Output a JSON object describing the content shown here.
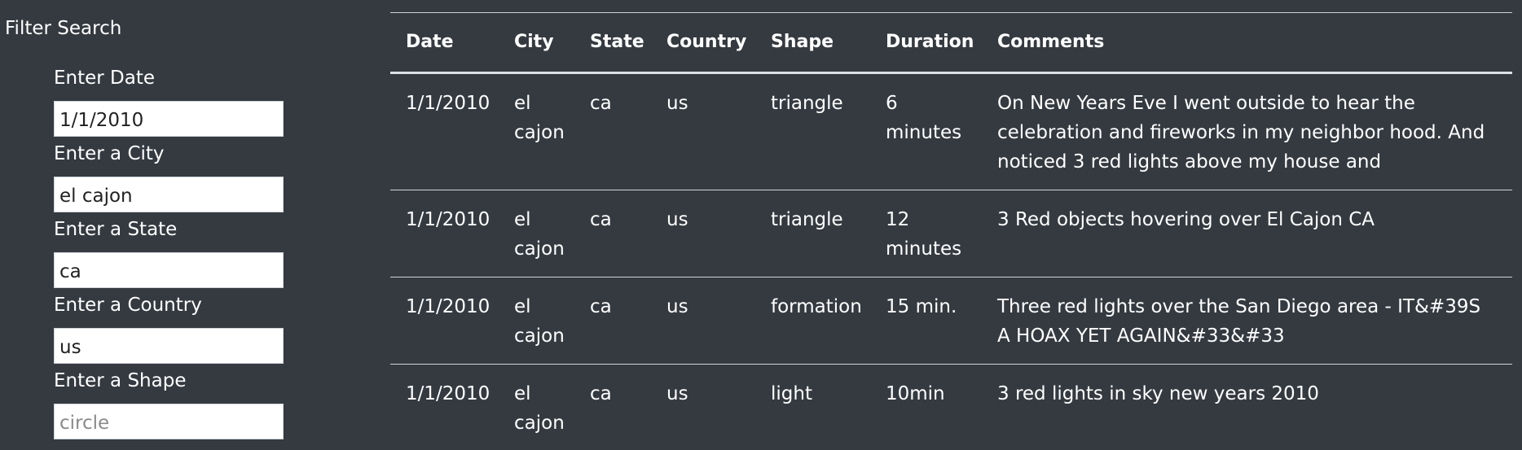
{
  "filter": {
    "title": "Filter Search",
    "fields": [
      {
        "label": "Enter Date",
        "value": "1/1/2010",
        "placeholder": ""
      },
      {
        "label": "Enter a City",
        "value": "el cajon",
        "placeholder": ""
      },
      {
        "label": "Enter a State",
        "value": "ca",
        "placeholder": ""
      },
      {
        "label": "Enter a Country",
        "value": "us",
        "placeholder": ""
      },
      {
        "label": "Enter a Shape",
        "value": "",
        "placeholder": "circle"
      }
    ]
  },
  "table": {
    "columns": [
      "Date",
      "City",
      "State",
      "Country",
      "Shape",
      "Duration",
      "Comments"
    ],
    "rows": [
      {
        "date": "1/1/2010",
        "city": "el cajon",
        "state": "ca",
        "country": "us",
        "shape": "triangle",
        "duration": "6 minutes",
        "comments": "On New Years Eve I went outside to hear the celebration and fireworks in my neighbor hood. And noticed 3 red lights above my house and"
      },
      {
        "date": "1/1/2010",
        "city": "el cajon",
        "state": "ca",
        "country": "us",
        "shape": "triangle",
        "duration": "12 minutes",
        "comments": "3 Red objects hovering over El Cajon CA"
      },
      {
        "date": "1/1/2010",
        "city": "el cajon",
        "state": "ca",
        "country": "us",
        "shape": "formation",
        "duration": "15 min.",
        "comments": "Three red lights over the San Diego area - IT&#39S A HOAX YET AGAIN&#33&#33"
      },
      {
        "date": "1/1/2010",
        "city": "el cajon",
        "state": "ca",
        "country": "us",
        "shape": "light",
        "duration": "10min",
        "comments": "3 red lights in sky new years 2010"
      }
    ]
  }
}
